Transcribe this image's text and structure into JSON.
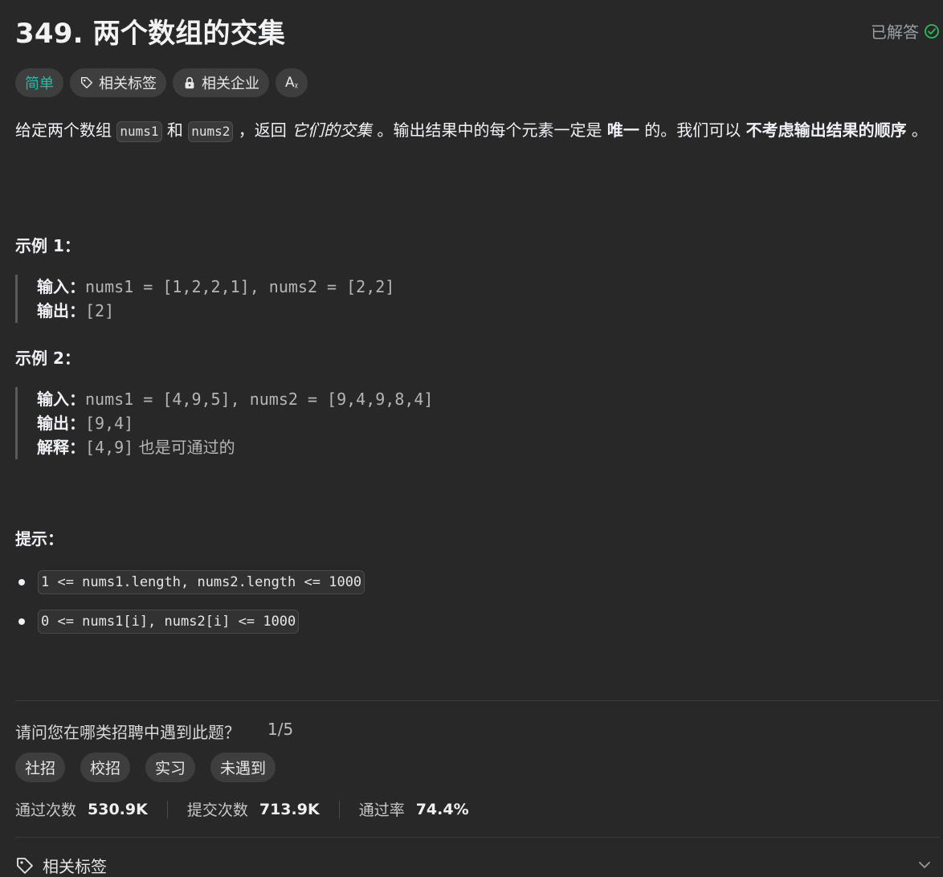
{
  "problem": {
    "title": "349. 两个数组的交集",
    "status": "已解答",
    "difficulty": "简单",
    "tag_related_topics": "相关标签",
    "tag_related_companies": "相关企业"
  },
  "description": {
    "p1": "给定两个数组 ",
    "code1": "nums1",
    "p2": " 和 ",
    "code2": "nums2",
    "p3": " ，返回 ",
    "em": "它们的交集",
    "p4": " 。输出结果中的每个元素一定是 ",
    "strong1": "唯一",
    "p5": " 的。我们可以 ",
    "strong2": "不考虑输出结果的顺序",
    "p6": " 。"
  },
  "examples": [
    {
      "title": "示例 1：",
      "input_label": "输入：",
      "input": "nums1 = [1,2,2,1], nums2 = [2,2]",
      "output_label": "输出：",
      "output": "[2]"
    },
    {
      "title": "示例 2：",
      "input_label": "输入：",
      "input": "nums1 = [4,9,5], nums2 = [9,4,9,8,4]",
      "output_label": "输出：",
      "output": "[9,4]",
      "explain_label": "解释：",
      "explain_code": "[4,9]",
      "explain_text": " 也是可通过的"
    }
  ],
  "constraints": {
    "title": "提示：",
    "items": [
      "1 <= nums1.length, nums2.length <= 1000",
      "0 <= nums1[i], nums2[i] <= 1000"
    ]
  },
  "survey": {
    "question": "请问您在哪类招聘中遇到此题？",
    "progress": "1/5",
    "options": [
      "社招",
      "校招",
      "实习",
      "未遇到"
    ]
  },
  "stats": {
    "accepted_label": "通过次数",
    "accepted_value": "530.9K",
    "submissions_label": "提交次数",
    "submissions_value": "713.9K",
    "rate_label": "通过率",
    "rate_value": "74.4%"
  },
  "footer": {
    "related_topics": "相关标签"
  },
  "colors": {
    "background": "#282828",
    "easy": "#2db8a5",
    "solved_check": "#2cbb5d"
  }
}
